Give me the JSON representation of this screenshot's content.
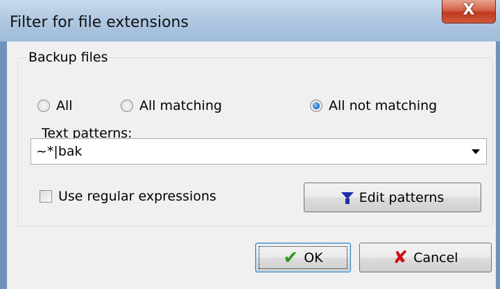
{
  "window": {
    "title": "Filter for file extensions",
    "close_icon": "close-icon",
    "close_glyph": "X"
  },
  "group": {
    "title": "Backup files",
    "radios": [
      {
        "label": "All",
        "selected": false
      },
      {
        "label": "All matching",
        "selected": false
      },
      {
        "label": "All not matching",
        "selected": true
      }
    ]
  },
  "patterns": {
    "label": "Text patterns:",
    "value": "~*|bak",
    "dropdown_icon": "dropdown-arrow-icon"
  },
  "regex": {
    "label": "Use regular expressions",
    "checked": false
  },
  "buttons": {
    "edit_label": "Edit patterns",
    "edit_icon": "filter-icon",
    "ok_label": "OK",
    "ok_icon": "checkmark-icon",
    "cancel_label": "Cancel",
    "cancel_icon": "x-cross-icon"
  },
  "colors": {
    "accent": "#3c7fb1",
    "ok_check": "#2d9a1c",
    "cancel_x": "#c8141a",
    "filter_icon": "#1c2fa8",
    "close_button": "#c0391f"
  }
}
